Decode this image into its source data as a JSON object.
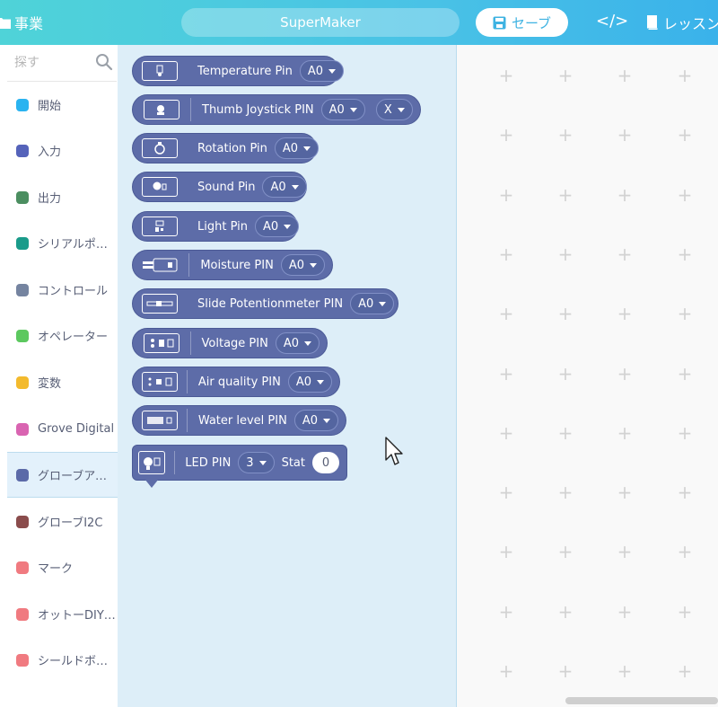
{
  "header": {
    "project_label": "事業",
    "title": "SuperMaker",
    "save_label": "セーブ",
    "code_label": "</>",
    "lesson_label": "レッスン"
  },
  "sidebar": {
    "search_placeholder": "探す",
    "categories": [
      {
        "label": "開始",
        "color": "#2ab3f0"
      },
      {
        "label": "入力",
        "color": "#5563ba"
      },
      {
        "label": "出力",
        "color": "#4b8e60"
      },
      {
        "label": "シリアルポート",
        "color": "#1a9b8a"
      },
      {
        "label": "コントロール",
        "color": "#7584a0"
      },
      {
        "label": "オペレーター",
        "color": "#5cc85f"
      },
      {
        "label": "変数",
        "color": "#f3ba2d"
      },
      {
        "label": "Grove Digital",
        "color": "#d964b1"
      },
      {
        "label": "グローブアナログ",
        "color": "#5b6aa8"
      },
      {
        "label": "グローブI2C",
        "color": "#8a4c4c"
      },
      {
        "label": "マーク",
        "color": "#f07a80"
      },
      {
        "label": "オットーDIYロボット",
        "color": "#f07a80"
      },
      {
        "label": "シールドボード",
        "color": "#f07a80"
      }
    ]
  },
  "blocks": [
    {
      "label": "Temperature Pin",
      "pin": "A0"
    },
    {
      "label": "Thumb Joystick PIN",
      "pin": "A0",
      "axis": "X"
    },
    {
      "label": "Rotation Pin",
      "pin": "A0"
    },
    {
      "label": "Sound Pin",
      "pin": "A0"
    },
    {
      "label": "Light Pin",
      "pin": "A0"
    },
    {
      "label": "Moisture PIN",
      "pin": "A0"
    },
    {
      "label": "Slide Potentionmeter PIN",
      "pin": "A0"
    },
    {
      "label": "Voltage PIN",
      "pin": "A0"
    },
    {
      "label": "Air quality PIN",
      "pin": "A0"
    },
    {
      "label": "Water level PIN",
      "pin": "A0"
    },
    {
      "label": "LED PIN",
      "pin": "3",
      "stat_label": "Stat",
      "stat_value": "0"
    }
  ],
  "colors": {
    "header_gradient_start": "#4fd3d8",
    "header_gradient_end": "#3ab2ea",
    "block_fill": "#5d6ca8",
    "flyout_bg": "#ddeef8",
    "active_category_bg": "#e3f1fb"
  },
  "icons": [
    "folder-icon",
    "save-icon",
    "code-icon",
    "book-icon",
    "search-icon",
    "cursor-icon"
  ]
}
